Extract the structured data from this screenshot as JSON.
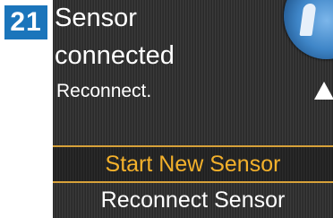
{
  "step": {
    "number": "21"
  },
  "screen": {
    "message_line_1": "Sensor",
    "message_line_2": "connected",
    "detail": "Reconnect.",
    "info_icon": "info-icon",
    "scroll_icon": "scroll-up-icon"
  },
  "menu": {
    "items": [
      {
        "label": "Start New Sensor",
        "selected": true
      },
      {
        "label": "Reconnect Sensor",
        "selected": false
      }
    ]
  },
  "colors": {
    "badge": "#1b75bb",
    "selected_text": "#f4b12b",
    "screen_bg": "#2e2e2e"
  }
}
